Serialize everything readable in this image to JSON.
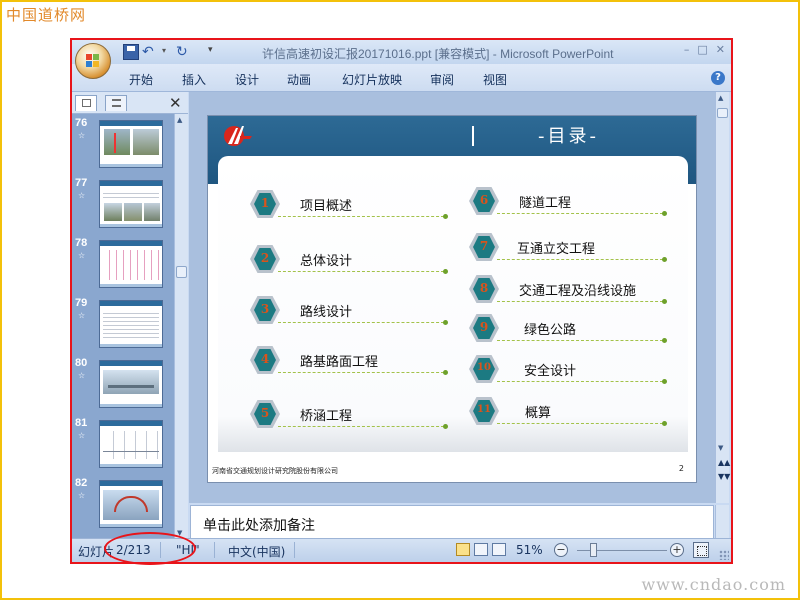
{
  "watermarks": {
    "top_left": "中国道桥网",
    "bottom_right": "www.cndao.com"
  },
  "window": {
    "title": "许信高速初设汇报20171016.ppt [兼容模式] - Microsoft PowerPoint",
    "controls": [
      "–",
      "□",
      "✕"
    ]
  },
  "quick_access": {
    "save_icon": "save-icon",
    "undo_icon": "undo-icon",
    "redo_icon": "redo-icon"
  },
  "ribbon": {
    "tabs": [
      "开始",
      "插入",
      "设计",
      "动画",
      "幻灯片放映",
      "审阅",
      "视图"
    ],
    "help": "?"
  },
  "left_panel": {
    "close": "✕",
    "thumbnails": [
      {
        "number": "76",
        "star": "☆"
      },
      {
        "number": "77",
        "star": "☆"
      },
      {
        "number": "78",
        "star": "☆"
      },
      {
        "number": "79",
        "star": "☆"
      },
      {
        "number": "80",
        "star": "☆"
      },
      {
        "number": "81",
        "star": "☆"
      },
      {
        "number": "82",
        "star": "☆"
      }
    ]
  },
  "slide": {
    "title": "-目录-",
    "toc_left": [
      {
        "num": "1",
        "label": "项目概述"
      },
      {
        "num": "2",
        "label": "总体设计"
      },
      {
        "num": "3",
        "label": "路线设计"
      },
      {
        "num": "4",
        "label": "路基路面工程"
      },
      {
        "num": "5",
        "label": "桥涵工程"
      }
    ],
    "toc_right": [
      {
        "num": "6",
        "label": "隧道工程"
      },
      {
        "num": "7",
        "label": "互通立交工程"
      },
      {
        "num": "8",
        "label": "交通工程及沿线设施"
      },
      {
        "num": "9",
        "label": "绿色公路"
      },
      {
        "num": "10",
        "label": "安全设计"
      },
      {
        "num": "11",
        "label": "概算"
      }
    ],
    "footer_company": "河南省交通规划设计研究院股份有限公司",
    "page_number": "2"
  },
  "notes": {
    "placeholder": "单击此处添加备注"
  },
  "status_bar": {
    "slide_label": "幻灯片",
    "slide_position": "2/213",
    "theme": "\"HI\"",
    "language": "中文(中国)",
    "zoom": "51%",
    "zoom_minus": "−",
    "zoom_plus": "+"
  },
  "colors": {
    "annotation": "#e8141a",
    "slide_header": "#1f5680",
    "hex_fill": "#1c7a82",
    "hex_number": "#d9541c"
  }
}
